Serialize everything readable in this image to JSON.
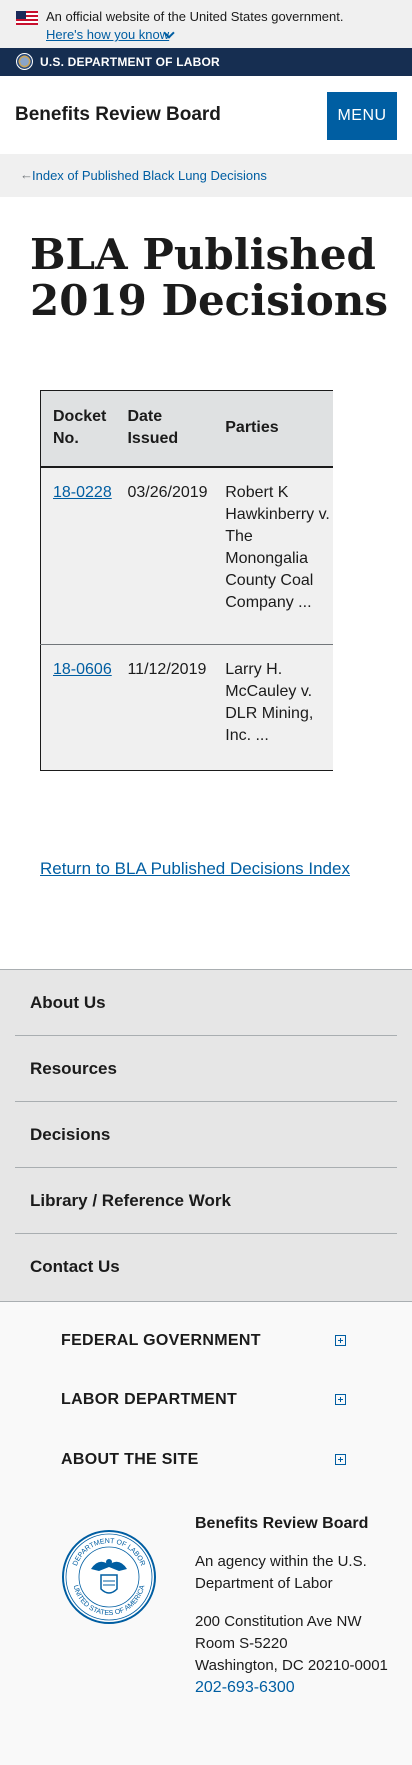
{
  "gov_banner": {
    "official_text": "An official website of the United States government.",
    "how_you_know": "Here's how you know"
  },
  "dept_bar": {
    "name": "U.S. DEPARTMENT OF LABOR"
  },
  "header": {
    "site_title": "Benefits Review Board",
    "menu_label": "MENU"
  },
  "breadcrumb": {
    "arrow": "←",
    "link": "Index of Published Black Lung Decisions"
  },
  "page": {
    "title": "BLA Published 2019 Decisions"
  },
  "table": {
    "headers": [
      "Docket No.",
      "Date Issued",
      "Parties"
    ],
    "rows": [
      {
        "docket": "18-0228",
        "date": "03/26/2019",
        "parties": "Robert K Hawkinberry v. The Monongalia County Coal Company ..."
      },
      {
        "docket": "18-0606",
        "date": "11/12/2019",
        "parties": "Larry H. McCauley v. DLR Mining, Inc. ..."
      }
    ]
  },
  "return_link": "Return to BLA Published Decisions Index",
  "footer_nav": [
    "About Us",
    "Resources",
    "Decisions",
    "Library / Reference Work",
    "Contact Us"
  ],
  "footer_accordion": [
    "FEDERAL GOVERNMENT",
    "LABOR DEPARTMENT",
    "ABOUT THE SITE"
  ],
  "contact": {
    "org": "Benefits Review Board",
    "agency": "An agency within the U.S. Department of Labor",
    "address_line1": "200 Constitution Ave NW",
    "address_line2": "Room S-5220",
    "address_line3": "Washington, DC 20210-0001",
    "phone": "202-693-6300"
  },
  "seal_text": {
    "top": "DEPARTMENT OF LABOR",
    "bottom": "UNITED STATES OF AMERICA"
  },
  "colors": {
    "link": "#005ea2",
    "dept_bar": "#162e51",
    "banner": "#f0f0f0"
  },
  "icons": [
    "us-flag-icon",
    "chevron-down-icon",
    "dol-seal-icon",
    "left-arrow-icon",
    "plus-icon"
  ]
}
